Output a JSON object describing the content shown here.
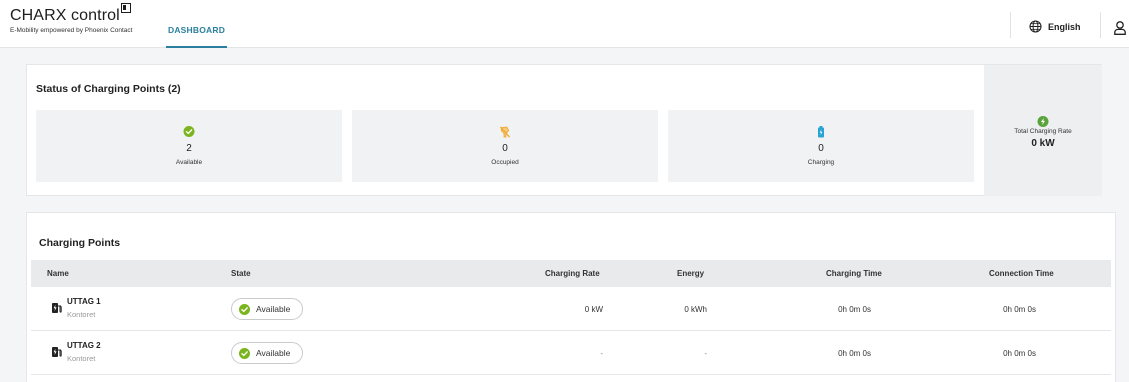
{
  "header": {
    "brand_title": "CHARX control",
    "brand_subtitle": "E-Mobility empowered by Phoenix Contact",
    "nav_tab": "DASHBOARD",
    "language": "English"
  },
  "status": {
    "title": "Status of Charging Points (2)",
    "tiles": [
      {
        "label": "Available",
        "value": "2",
        "icon": "check-circle-icon",
        "color": "#7ab51d"
      },
      {
        "label": "Occupied",
        "value": "0",
        "icon": "unplugged-icon",
        "color": "#f0a830"
      },
      {
        "label": "Charging",
        "value": "0",
        "icon": "battery-icon",
        "color": "#2aa3d6"
      }
    ],
    "total": {
      "label": "Total Charging Rate",
      "value": "0 kW",
      "icon": "bolt-circle-icon",
      "color": "#5aa33c"
    }
  },
  "charging_points": {
    "title": "Charging Points",
    "columns": [
      "Name",
      "State",
      "Charging Rate",
      "Energy",
      "Charging Time",
      "Connection Time"
    ],
    "rows": [
      {
        "name": "UTTAG 1",
        "location": "Kontoret",
        "state": "Available",
        "rate": "0 kW",
        "energy": "0 kWh",
        "charging_time": "0h 0m 0s",
        "connection_time": "0h 0m 0s"
      },
      {
        "name": "UTTAG 2",
        "location": "Kontoret",
        "state": "Available",
        "rate": "-",
        "energy": "-",
        "charging_time": "0h 0m 0s",
        "connection_time": "0h 0m 0s"
      }
    ]
  },
  "colors": {
    "accent": "#2a7f9e",
    "available": "#7ab51d"
  }
}
